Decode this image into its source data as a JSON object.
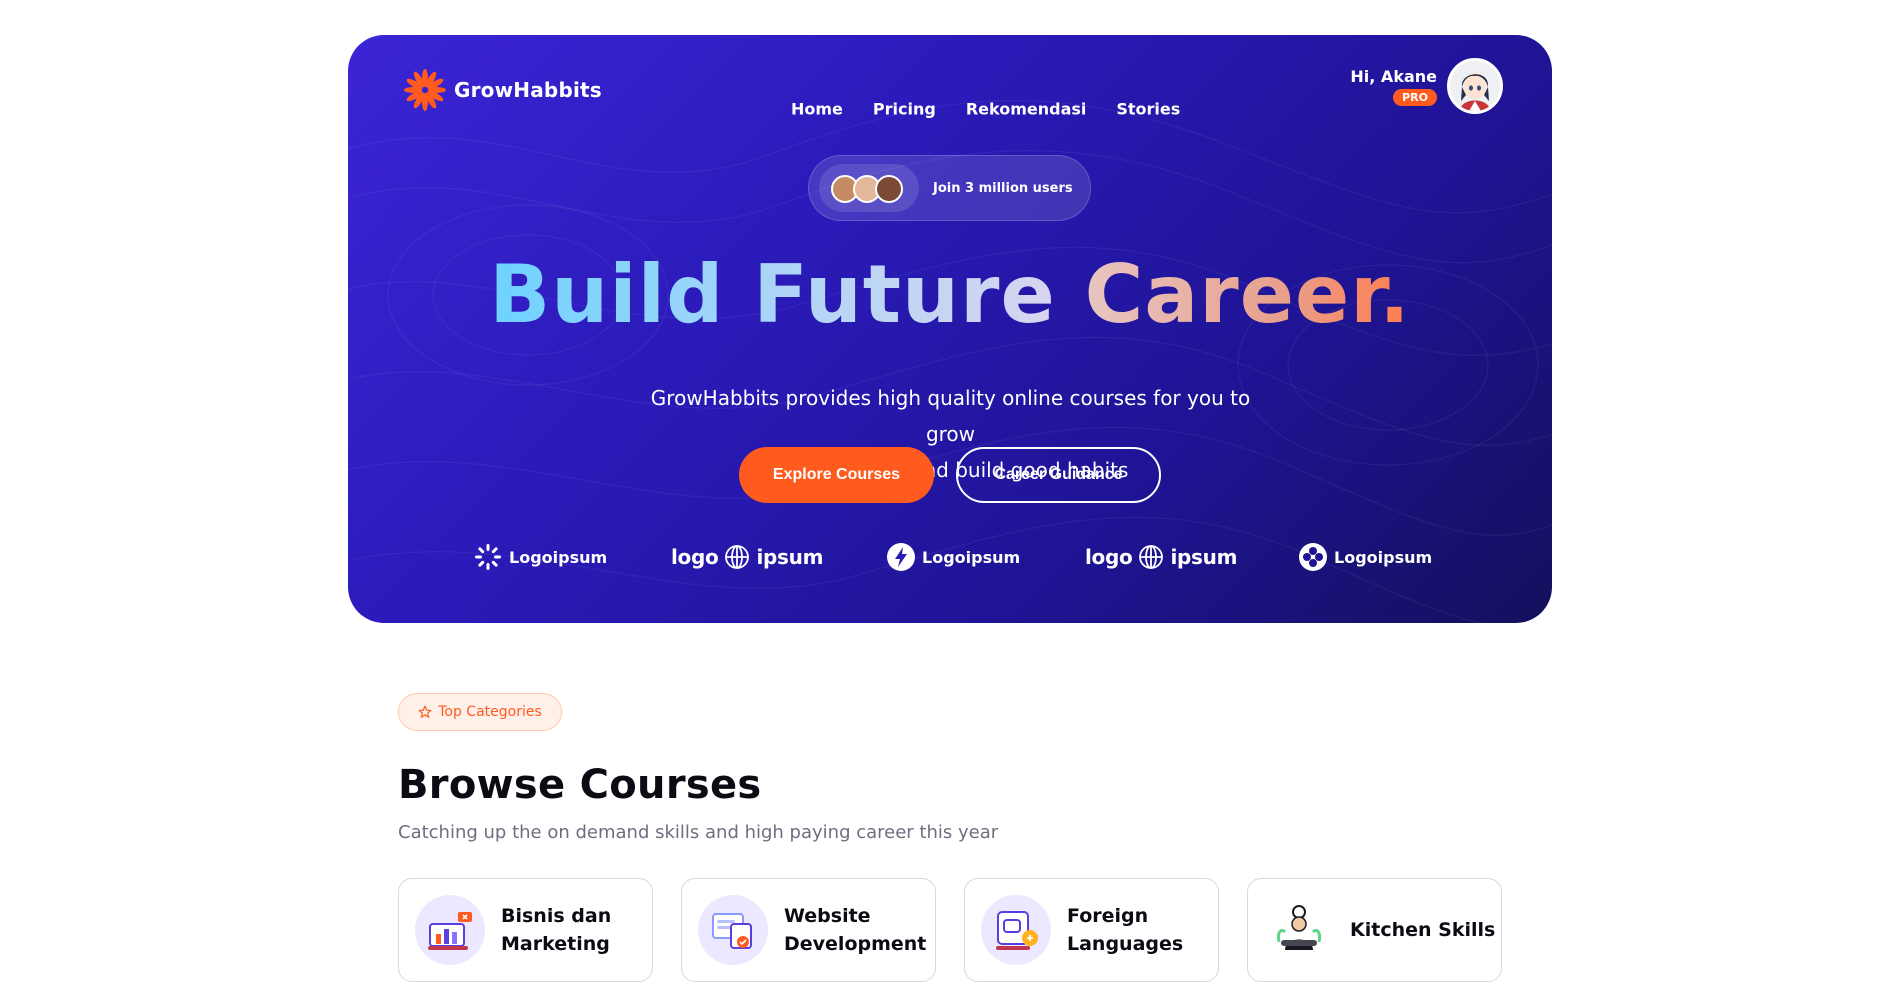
{
  "brand": {
    "name": "GrowHabbits",
    "accent": "#ff5b1e",
    "hero_bg": "#2a1ab7"
  },
  "nav": {
    "items": [
      "Home",
      "Pricing",
      "Rekomendasi",
      "Stories"
    ]
  },
  "user": {
    "greeting": "Hi, Akane",
    "badge": "PRO"
  },
  "hero": {
    "join_label": "Join 3 million users",
    "headline_part1": "Build Future",
    "headline_part2": "Career.",
    "subtitle_line1": "GrowHabbits provides high quality online courses for you to grow",
    "subtitle_line2": "your Hobbies and build good habits",
    "primary_cta": "Explore Courses",
    "secondary_cta": "Career Guidance"
  },
  "partner_logos": [
    {
      "icon": "sunburst-icon",
      "text": "Logoipsum"
    },
    {
      "icon": "globe-icon",
      "text_a": "logo",
      "text_b": "ipsum"
    },
    {
      "icon": "bolt-icon",
      "text": "Logoipsum"
    },
    {
      "icon": "globe-icon",
      "text_a": "logo",
      "text_b": "ipsum"
    },
    {
      "icon": "clover-icon",
      "text": "Logoipsum"
    }
  ],
  "section": {
    "pill": "Top Categories",
    "title": "Browse Courses",
    "subtitle": "Catching up the on demand skills and high paying career this year"
  },
  "categories": [
    {
      "label_line1": "Bisnis dan",
      "label_line2": "Marketing",
      "icon": "chart-icon"
    },
    {
      "label_line1": "Website",
      "label_line2": "Development",
      "icon": "web-dev-icon"
    },
    {
      "label_line1": "Foreign",
      "label_line2": "Languages",
      "icon": "translate-icon"
    },
    {
      "label_line1": "Kitchen Skills",
      "label_line2": "",
      "icon": "chef-icon"
    }
  ]
}
